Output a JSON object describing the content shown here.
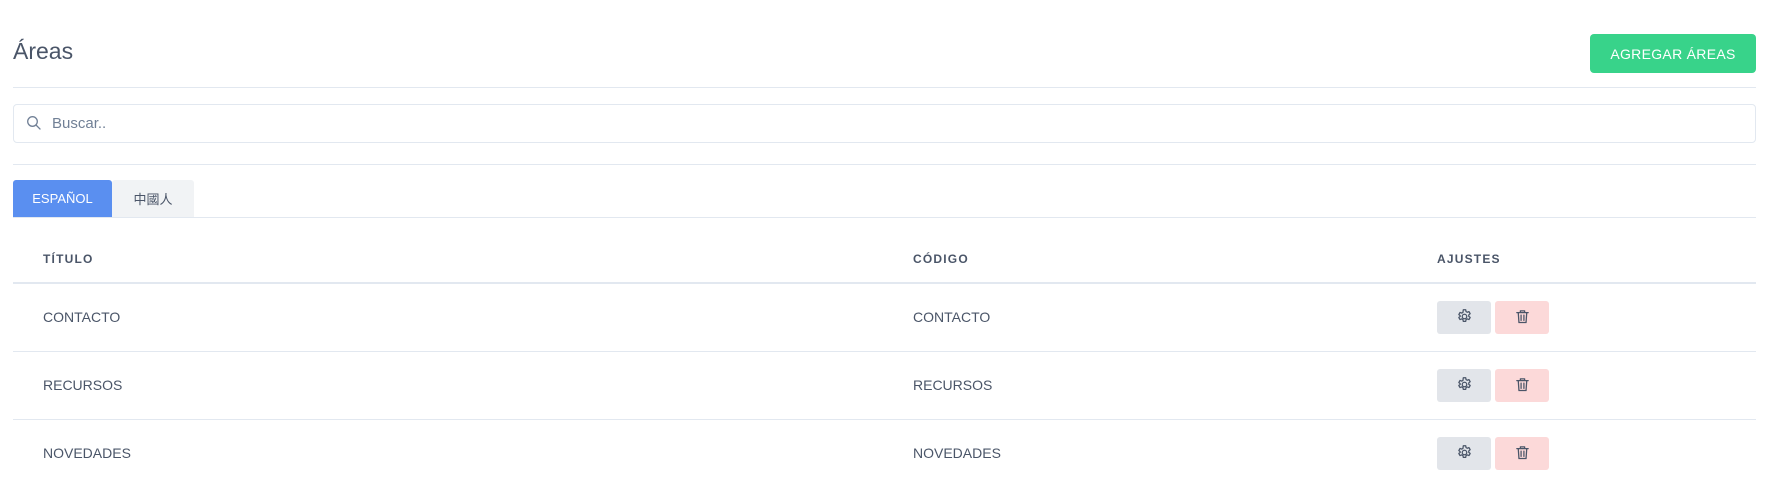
{
  "header": {
    "title": "Áreas",
    "add_button_label": "AGREGAR ÁREAS"
  },
  "search": {
    "placeholder": "Buscar..",
    "value": ""
  },
  "tabs": [
    {
      "label": "ESPAÑOL",
      "active": true
    },
    {
      "label": "中國人",
      "active": false
    }
  ],
  "table": {
    "columns": [
      "TÍTULO",
      "CÓDIGO",
      "AJUSTES"
    ],
    "rows": [
      {
        "titulo": "CONTACTO",
        "codigo": "CONTACTO"
      },
      {
        "titulo": "RECURSOS",
        "codigo": "RECURSOS"
      },
      {
        "titulo": "NOVEDADES",
        "codigo": "NOVEDADES"
      }
    ]
  },
  "icons": {
    "search": "search-icon",
    "settings": "gear-icon",
    "delete": "trash-icon"
  },
  "colors": {
    "accent_green": "#38d38a",
    "tab_active_blue": "#5a8ff0",
    "delete_bg": "#fcd9d9",
    "settings_bg": "#e2e5ea"
  }
}
